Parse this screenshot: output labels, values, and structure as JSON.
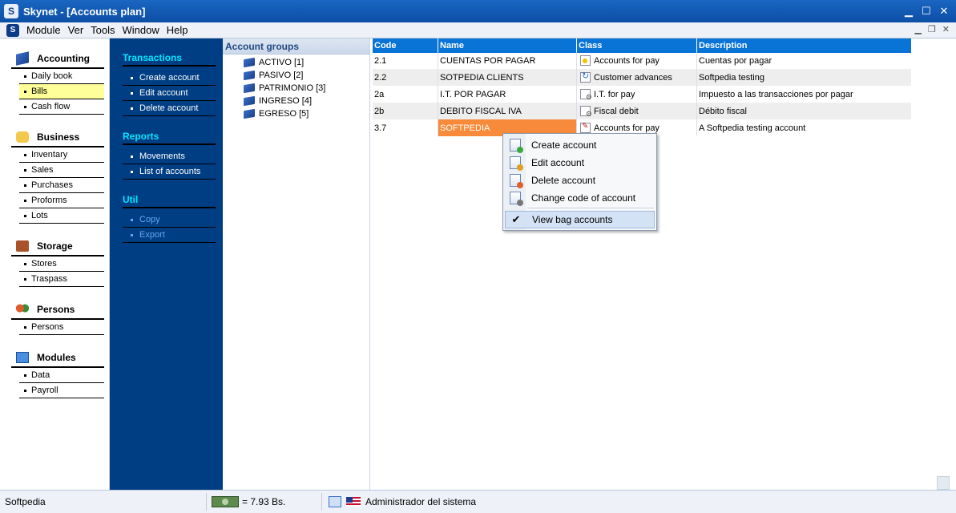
{
  "window": {
    "title": "Skynet - [Accounts plan]",
    "icon": "S"
  },
  "menubar": {
    "items": [
      "Module",
      "Ver",
      "Tools",
      "Window",
      "Help"
    ]
  },
  "leftnav": {
    "sections": [
      {
        "label": "Accounting",
        "icon": "book-icon",
        "items": [
          "Daily book",
          "Bills",
          "Cash flow"
        ],
        "active": "Bills"
      },
      {
        "label": "Business",
        "icon": "hand-icon",
        "items": [
          "Inventary",
          "Sales",
          "Purchases",
          "Proforms",
          "Lots"
        ]
      },
      {
        "label": "Storage",
        "icon": "briefcase-icon",
        "items": [
          "Stores",
          "Traspass"
        ]
      },
      {
        "label": "Persons",
        "icon": "people-icon",
        "items": [
          "Persons"
        ]
      },
      {
        "label": "Modules",
        "icon": "modules-icon",
        "items": [
          "Data",
          "Payroll"
        ]
      }
    ]
  },
  "taskpanel": {
    "transactions": {
      "label": "Transactions",
      "items": [
        "Create account",
        "Edit account",
        "Delete account"
      ]
    },
    "reports": {
      "label": "Reports",
      "items": [
        "Movements",
        "List of accounts"
      ]
    },
    "util": {
      "label": "Util",
      "items": [
        "Copy",
        "Export"
      ]
    }
  },
  "groups": {
    "header": "Account groups",
    "items": [
      "ACTIVO [1]",
      "PASIVO [2]",
      "PATRIMONIO [3]",
      "INGRESO [4]",
      "EGRESO [5]"
    ]
  },
  "grid": {
    "columns": [
      "Code",
      "Name",
      "Class",
      "Description"
    ],
    "rows": [
      {
        "code": "2.1",
        "name": "CUENTAS POR PAGAR",
        "class": "Accounts for pay",
        "class_icon": "star-icon",
        "description": "Cuentas por pagar"
      },
      {
        "code": "2.2",
        "name": "SOTPEDIA CLIENTS",
        "class": "Customer advances",
        "class_icon": "refresh-icon",
        "description": "Softpedia testing"
      },
      {
        "code": "2a",
        "name": "I.T. POR PAGAR",
        "class": "I.T. for pay",
        "class_icon": "gear-icon",
        "description": "Impuesto a las transacciones por pagar"
      },
      {
        "code": "2b",
        "name": "DEBITO FISCAL IVA",
        "class": "Fiscal debit",
        "class_icon": "gear-icon",
        "description": "Débito fiscal"
      },
      {
        "code": "3.7",
        "name": "SOFTPEDIA",
        "class": "Accounts for pay",
        "class_icon": "edit-icon",
        "description": "A Softpedia testing account"
      }
    ],
    "selected_row": 4
  },
  "context_menu": {
    "items": [
      "Create account",
      "Edit account",
      "Delete account",
      "Change code of account"
    ],
    "checked_item": "View bag accounts"
  },
  "statusbar": {
    "left": "Softpedia",
    "currency": "= 7.93 Bs.",
    "user": "Administrador del sistema"
  },
  "colors": {
    "accent": "#0a73d6",
    "panel": "#003e84",
    "selection": "#f78a3b",
    "active_nav": "#ffff99"
  }
}
